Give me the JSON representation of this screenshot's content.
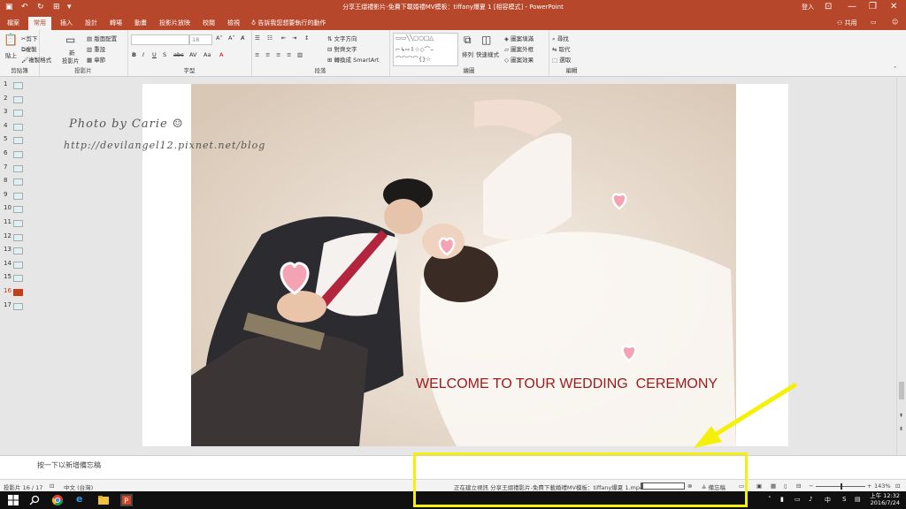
{
  "titlebar": {
    "title": "分享王熠禮影片-免費下載婚禮MV模板：tiffany爆夏 1 [相容模式] - PowerPoint",
    "login": "登入",
    "save_icon": "save-icon",
    "undo_icon": "undo-icon",
    "redo_icon": "redo-icon",
    "start_icon": "slideshow-start-icon"
  },
  "tabs": {
    "items": [
      "檔案",
      "常用",
      "插入",
      "設計",
      "轉場",
      "動畫",
      "投影片放映",
      "校閱",
      "檢視"
    ],
    "active": "常用",
    "tellme": "告訴我您想要執行的動作",
    "share": "共用"
  },
  "ribbon": {
    "clipboard": {
      "label": "剪貼簿",
      "paste": "貼上",
      "cut": "剪下",
      "copy": "複製",
      "format_painter": "複製格式"
    },
    "slides": {
      "label": "投影片",
      "new_slide_1": "新",
      "new_slide_2": "投影片",
      "layout": "版面配置",
      "reset": "重設",
      "section": "章節"
    },
    "font": {
      "label": "字型",
      "font_size": "18"
    },
    "paragraph": {
      "label": "段落",
      "text_direction": "文字方向",
      "align_text": "對齊文字",
      "smartart": "轉換成 SmartArt"
    },
    "drawing": {
      "label": "繪圖",
      "arrange": "排列",
      "quick_styles": "快速樣式",
      "shape_fill": "圖案填滿",
      "shape_outline": "圖案外框",
      "shape_effects": "圖案效果"
    },
    "editing": {
      "label": "編輯",
      "find": "尋找",
      "replace": "取代",
      "select": "選取"
    }
  },
  "thumbnails": {
    "numbers": [
      "1",
      "2",
      "3",
      "4",
      "5",
      "6",
      "7",
      "8",
      "9",
      "10",
      "11",
      "12",
      "13",
      "14",
      "15",
      "16",
      "17"
    ],
    "active": "16"
  },
  "slide": {
    "watermark_line1": "Photo by Carie ☺",
    "watermark_line2": "http://devilangel12.pixnet.net/blog",
    "welcome_text": "WELCOME TO TOUR WEDDING  CEREMONY"
  },
  "notes": {
    "placeholder": "按一下以新增備忘稿"
  },
  "status": {
    "slide_count": "投影片 16 / 17",
    "language": "中文 (台灣)",
    "video_status": "正在建立視訊 分享王熠禮影片-免費下載婚禮MV模板：tiffany爆夏 1.mp4",
    "progress": 0.04,
    "notes_button": "備忘稿",
    "zoom": "143%"
  },
  "taskbar": {
    "tray_lang": "中",
    "tray_s": "S",
    "time": "上午 12:32",
    "date": "2016/7/24"
  },
  "colors": {
    "accent": "#b7472a",
    "highlight": "#f5f00a",
    "welcome": "#9e1a1a"
  }
}
